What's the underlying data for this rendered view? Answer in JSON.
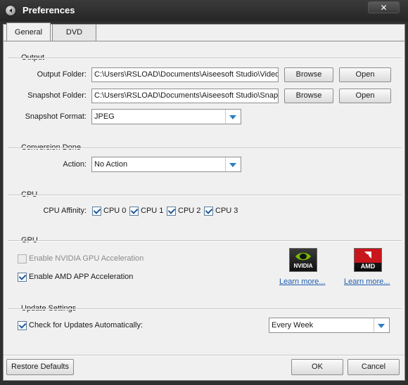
{
  "window": {
    "title": "Preferences",
    "close_glyph": "✕"
  },
  "tabs": [
    {
      "label": "General"
    },
    {
      "label": "DVD"
    }
  ],
  "output": {
    "heading": "Output",
    "output_folder_label": "Output Folder:",
    "output_folder_value": "C:\\Users\\RSLOAD\\Documents\\Aiseesoft Studio\\Video",
    "snapshot_folder_label": "Snapshot Folder:",
    "snapshot_folder_value": "C:\\Users\\RSLOAD\\Documents\\Aiseesoft Studio\\Snapshot",
    "browse_label": "Browse",
    "open_label": "Open",
    "snapshot_format_label": "Snapshot Format:",
    "snapshot_format_value": "JPEG"
  },
  "conversion": {
    "heading": "Conversion Done",
    "action_label": "Action:",
    "action_value": "No Action"
  },
  "cpu": {
    "heading": "CPU",
    "affinity_label": "CPU Affinity:",
    "cores": [
      {
        "label": "CPU 0",
        "checked": true
      },
      {
        "label": "CPU 1",
        "checked": true
      },
      {
        "label": "CPU 2",
        "checked": true
      },
      {
        "label": "CPU 3",
        "checked": true
      }
    ]
  },
  "gpu": {
    "heading": "GPU",
    "nvidia_label": "Enable NVIDIA GPU Acceleration",
    "nvidia_checked": false,
    "amd_label": "Enable AMD APP Acceleration",
    "amd_checked": true,
    "nvidia_logo_text": "NVIDIA",
    "amd_logo_text": "AMD",
    "learn_more": "Learn more..."
  },
  "update": {
    "heading": "Update Settings",
    "check_label": "Check for Updates Automatically:",
    "check_checked": true,
    "frequency_value": "Every Week"
  },
  "footer": {
    "restore_label": "Restore Defaults",
    "ok_label": "OK",
    "cancel_label": "Cancel"
  },
  "colors": {
    "accent": "#2a7fc4",
    "link": "#1f5fb0",
    "title_bar": "#2b2b2b",
    "nvidia_green": "#76b900",
    "amd_red": "#c8161d"
  }
}
